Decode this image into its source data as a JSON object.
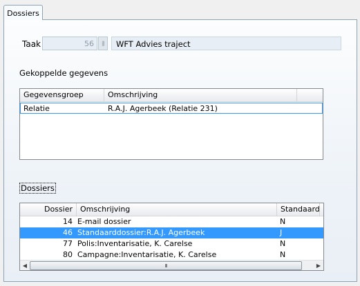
{
  "tab": {
    "label": "Dossiers"
  },
  "taak": {
    "label": "Taak",
    "number": "56",
    "button_glyph": "|||",
    "description": "WFT Advies traject"
  },
  "gekoppeld": {
    "label": "Gekoppelde gegevens",
    "columns": [
      "Gegevensgroep",
      "Omschrijving"
    ],
    "rows": [
      {
        "groep": "Relatie",
        "omschrijving": "R.A.J. Agerbeek (Relatie 231)"
      }
    ]
  },
  "dossiers": {
    "label": "Dossiers",
    "columns": [
      "Dossier",
      "Omschrijving",
      "Standaard"
    ],
    "rows": [
      {
        "dossier": "14",
        "omschrijving": "E-mail dossier",
        "standaard": "N"
      },
      {
        "dossier": "46",
        "omschrijving": "Standaarddossier:R.A.J. Agerbeek",
        "standaard": "J"
      },
      {
        "dossier": "77",
        "omschrijving": "Polis:Inventarisatie, K.  Carelse",
        "standaard": "N"
      },
      {
        "dossier": "80",
        "omschrijving": "Campagne:Inventarisatie, K.  Carelse",
        "standaard": "N"
      }
    ],
    "selected_index": 1,
    "scroll": {
      "left": "◀",
      "right": "▶",
      "grip": "III"
    }
  },
  "colors": {
    "selection": "#3399ff",
    "border": "#828790"
  }
}
